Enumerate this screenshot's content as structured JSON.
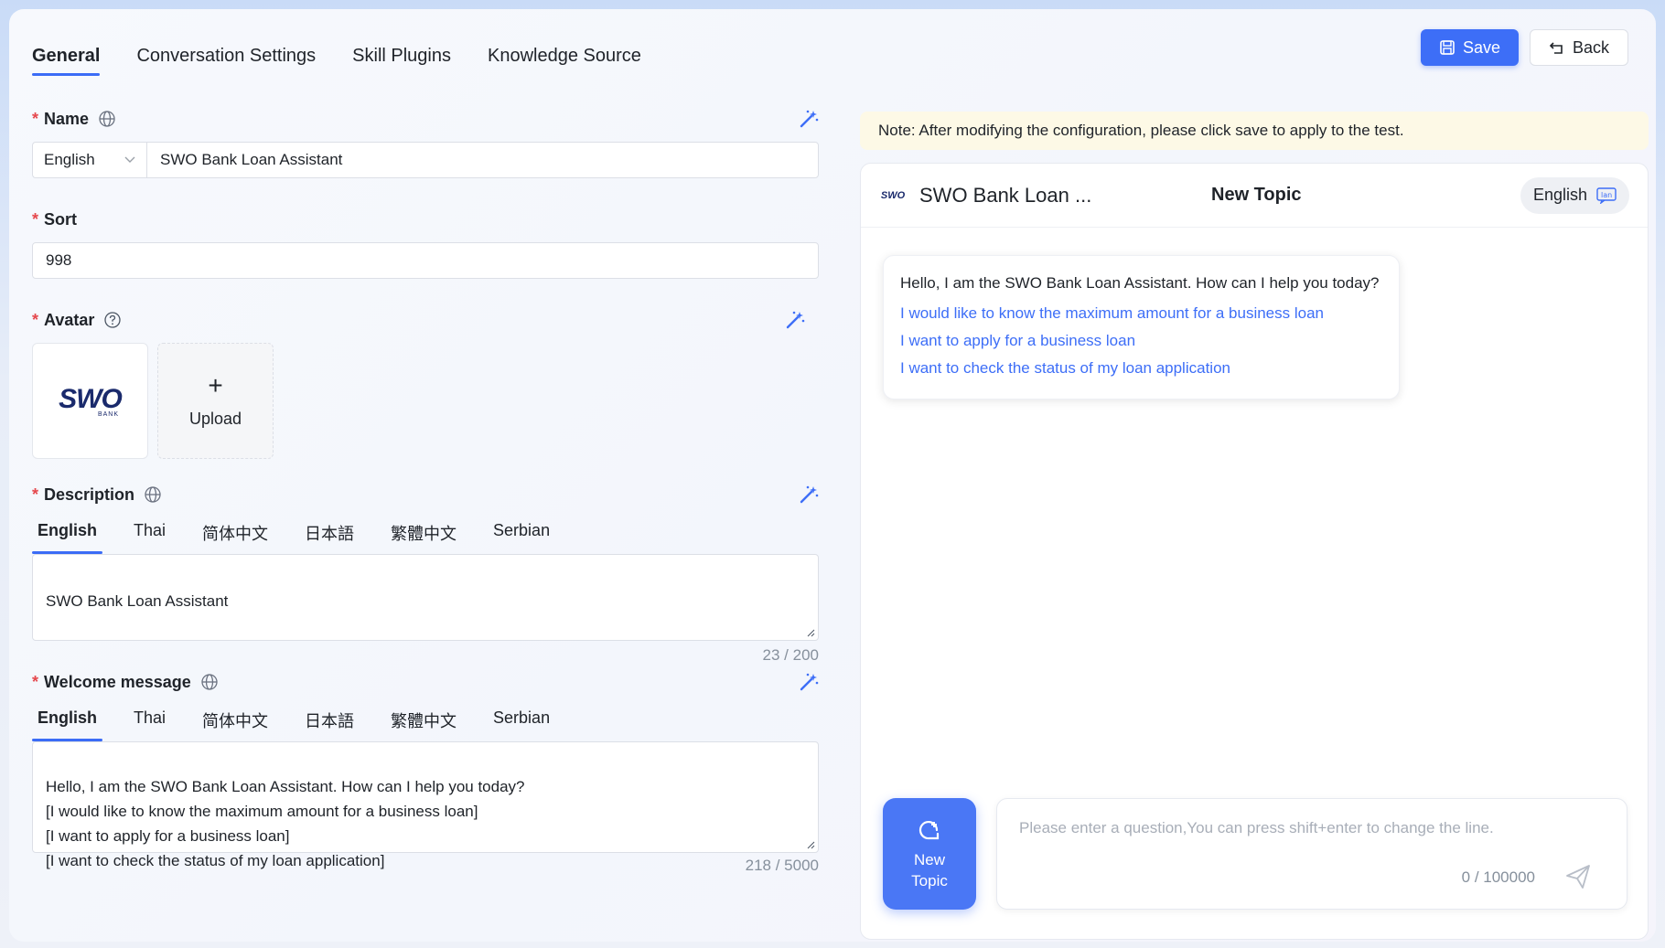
{
  "tabs": [
    {
      "label": "General",
      "active": true
    },
    {
      "label": "Conversation Settings"
    },
    {
      "label": "Skill Plugins"
    },
    {
      "label": "Knowledge Source"
    }
  ],
  "buttons": {
    "save": "Save",
    "back": "Back"
  },
  "form": {
    "name": {
      "label": "Name",
      "language": "English",
      "value": "SWO Bank Loan Assistant"
    },
    "sort": {
      "label": "Sort",
      "value": "998"
    },
    "avatar": {
      "label": "Avatar",
      "logo_text": "SWO",
      "logo_sub": "BANK",
      "upload_label": "Upload",
      "upload_plus": "+"
    },
    "description": {
      "label": "Description",
      "languages": [
        "English",
        "Thai",
        "简体中文",
        "日本語",
        "繁體中文",
        "Serbian"
      ],
      "value": "SWO Bank Loan Assistant",
      "count": "23 / 200"
    },
    "welcome": {
      "label": "Welcome message",
      "languages": [
        "English",
        "Thai",
        "简体中文",
        "日本語",
        "繁體中文",
        "Serbian"
      ],
      "value": "Hello, I am the SWO Bank Loan Assistant. How can I help you today?\n[I would like to know the maximum amount for a business loan]\n[I want to apply for a business loan]\n[I want to check the status of my loan application]",
      "count": "218 / 5000"
    }
  },
  "note": "Note: After modifying the configuration, please click save to apply to the test.",
  "chat": {
    "bot_name": "SWO Bank Loan ...",
    "logo_text": "SWO",
    "topic": "New Topic",
    "language": "English",
    "greeting": "Hello, I am the SWO Bank Loan Assistant. How can I help you today?",
    "suggestions": [
      "I would like to know the maximum amount for a business loan",
      "I want to apply for a business loan",
      "I want to check the status of my loan application"
    ],
    "new_topic_line1": "New",
    "new_topic_line2": "Topic",
    "input_placeholder": "Please enter a question,You can press shift+enter to change the line.",
    "input_count": "0 / 100000"
  },
  "colors": {
    "accent": "#3d6ef7",
    "required": "#e5484d",
    "note_bg": "#fdf9e6"
  }
}
